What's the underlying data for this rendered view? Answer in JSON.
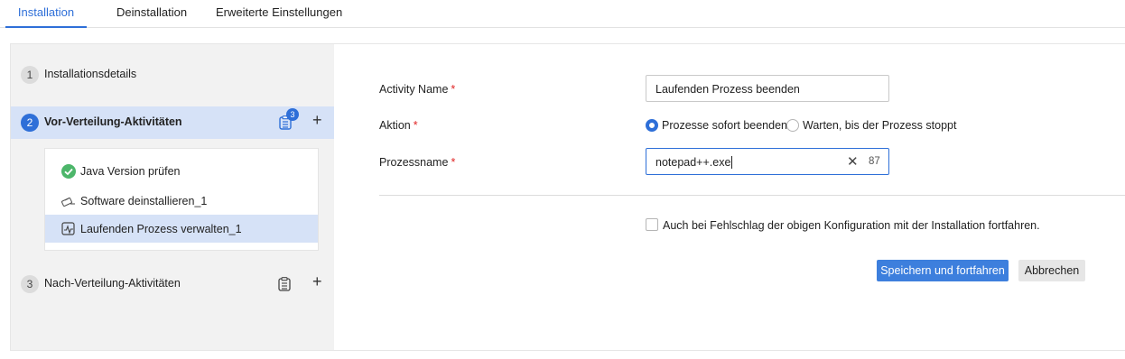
{
  "tabs": [
    "Installation",
    "Deinstallation",
    "Erweiterte Einstellungen"
  ],
  "steps": [
    {
      "number": "1",
      "label": "Installationsdetails"
    },
    {
      "number": "2",
      "label": "Vor-Verteilung-Aktivitäten",
      "badge": "3"
    },
    {
      "number": "3",
      "label": "Nach-Verteilung-Aktivitäten"
    }
  ],
  "substeps": [
    {
      "label": "Java Version prüfen",
      "icon": "check-circle-icon"
    },
    {
      "label": "Software deinstallieren_1",
      "icon": "uninstall-icon"
    },
    {
      "label": "Laufenden Prozess verwalten_1",
      "icon": "process-icon"
    }
  ],
  "form": {
    "activity_label": "Activity Name",
    "activity_value": "Laufenden Prozess beenden",
    "action_label": "Aktion",
    "action_options": [
      "Prozesse sofort beenden",
      "Warten, bis der Prozess stoppt"
    ],
    "selected_action": "Prozesse sofort beenden",
    "process_label": "Prozessname",
    "process_value": "notepad++.exe",
    "process_counter": "87",
    "required_mark": "*",
    "continue_label": "Auch bei Fehlschlag der obigen Konfiguration mit der Installation fortfahren.",
    "continue_checked": false
  },
  "buttons": {
    "save": "Speichern und fortfahren",
    "cancel": "Abbrechen"
  },
  "colors": {
    "accent": "#2e6fd8",
    "selected_bg": "#d6e2f7",
    "success": "#4cb66a",
    "required": "#e02424"
  }
}
